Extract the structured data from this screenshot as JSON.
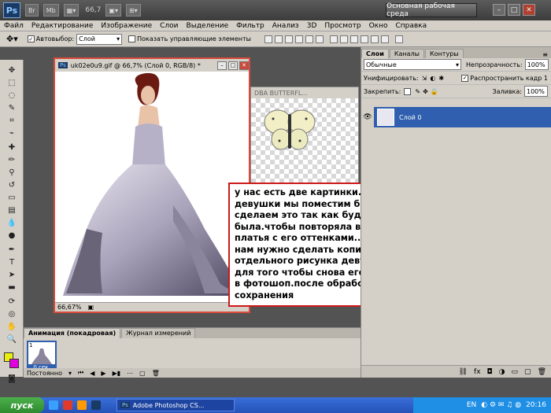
{
  "appbar": {
    "logo": "Ps",
    "zoom": "66,7",
    "workspace": "Основная рабочая среда",
    "btn_mb": "Mb",
    "minimize": "–",
    "restore": "□",
    "close": "✕"
  },
  "menu": [
    "Файл",
    "Редактирование",
    "Изображение",
    "Слои",
    "Выделение",
    "Фильтр",
    "Анализ",
    "3D",
    "Просмотр",
    "Окно",
    "Справка"
  ],
  "options": {
    "autoselect_label": "Автовыбор:",
    "autoselect_value": "Слой",
    "show_controls_label": "Показать управляющие элементы"
  },
  "doc1": {
    "title": "uk02e0u9.gif @ 66,7% (Слой 0, RGB/8) *",
    "zoom": "66,67%"
  },
  "doc2": {
    "title": "DBA BUTTERFL..."
  },
  "note": {
    "text": "у нас есть две картинки..на платье девушки мы поместим бабочку..но сделаем это так как буд-то она там и была.чтобы повторяла все изгибы платья с его оттенками..для этого нам нужно сделать копию отдельного рисунка девушки..это для того чтобы снова его не заносить в фотошоп.после обработки и сохранения"
  },
  "layers": {
    "tabs": [
      "Слои",
      "Каналы",
      "Контуры"
    ],
    "blend_mode": "Обычные",
    "opacity_label": "Непрозрачность:",
    "opacity_value": "100%",
    "unify_label": "Унифицировать:",
    "propagate_label": "Распространить кадр 1",
    "lock_label": "Закрепить:",
    "fill_label": "Заливка:",
    "fill_value": "100%",
    "layer_name": "Слой 0"
  },
  "animation": {
    "tabs": [
      "Анимация (покадровая)",
      "Журнал измерений"
    ],
    "frame_number": "1",
    "frame_delay": "0 сек.",
    "loop": "Постоянно"
  },
  "taskbar": {
    "start": "пуск",
    "task": "Adobe Photoshop CS...",
    "lang": "EN",
    "time": "20:16"
  },
  "colors": {
    "foreground": "#e9ee10",
    "background": "#e000e0",
    "accent_border": "#cc1a1a"
  }
}
